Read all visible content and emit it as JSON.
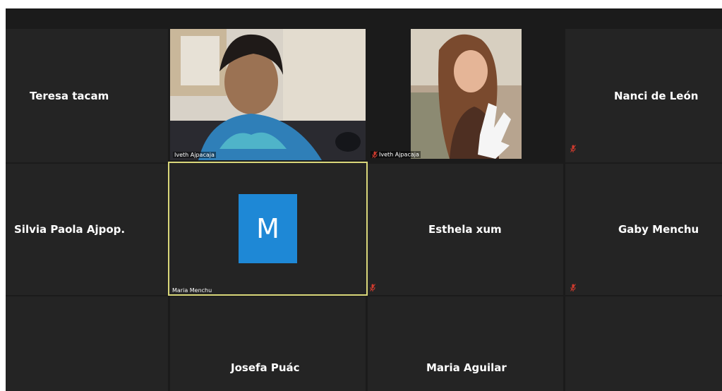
{
  "meeting": {
    "active_speaker_color": "#d9d77a",
    "avatar_color": "#1e88d6",
    "participants": [
      {
        "name": "Teresa tacam"
      },
      {
        "name": "Iveth Ajpacaja",
        "video": true
      },
      {
        "name": "Iveth Ajpacaja",
        "video": true,
        "muted": true
      },
      {
        "name": "Nanci de León",
        "muted": true
      },
      {
        "name": "Silvia Paola Ajpop."
      },
      {
        "name": "Maria Menchu",
        "avatar_letter": "M",
        "active_speaker": true
      },
      {
        "name": "Esthela xum",
        "muted": true
      },
      {
        "name": "Gaby Menchu",
        "muted": true
      },
      {
        "name": "Josefa Puác"
      },
      {
        "name": "Maria Aguilar"
      }
    ]
  }
}
